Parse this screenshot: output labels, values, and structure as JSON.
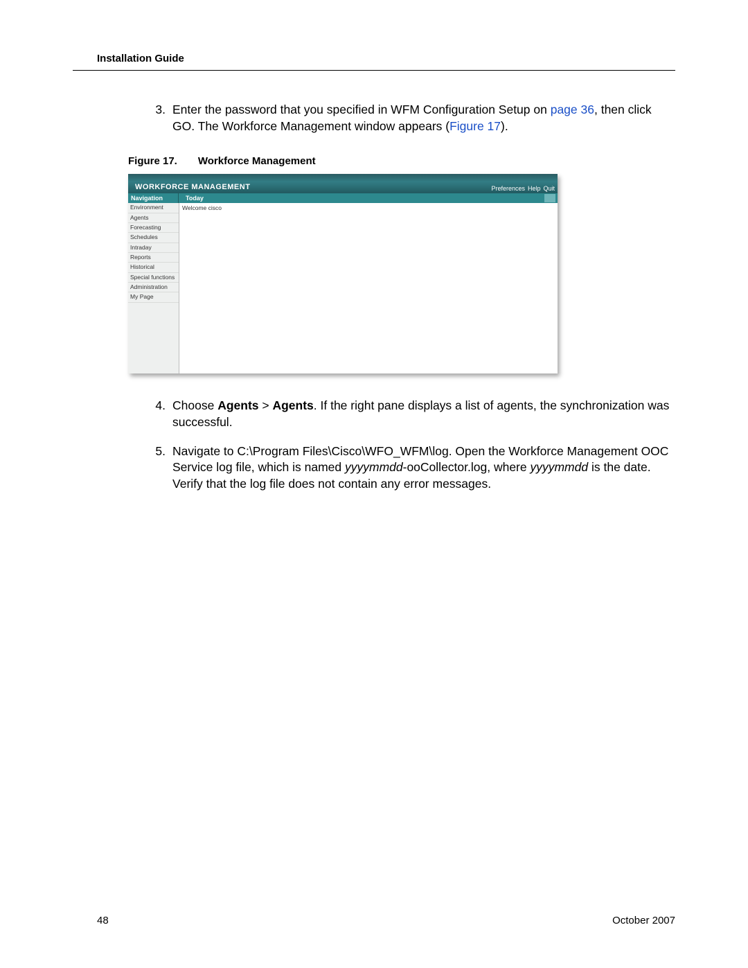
{
  "header": {
    "title": "Installation Guide"
  },
  "steps": {
    "s3": {
      "num": "3.",
      "pre": "Enter the password that you specified in WFM Configuration Setup on ",
      "link1": "page 36",
      "mid": ", then click GO. The Workforce Management window appears (",
      "link2": "Figure 17",
      "post": ")."
    },
    "s4": {
      "num": "4.",
      "pre": "Choose ",
      "b1": "Agents",
      "gt": " > ",
      "b2": "Agents",
      "post": ". If the right pane displays a list of agents, the synchronization was successful."
    },
    "s5": {
      "num": "5.",
      "pre": "Navigate to C:\\Program Files\\Cisco\\WFO_WFM\\log. Open the Workforce Management OOC Service log file, which is named ",
      "i1": "yyyymmdd",
      "mid1": "-ooCollector.log, where ",
      "i2": "yyyymmdd",
      "post": " is the date. Verify that the log file does not contain any error messages."
    }
  },
  "figure": {
    "num": "Figure 17.",
    "title": "Workforce Management"
  },
  "shot": {
    "title": "WORKFORCE MANAGEMENT",
    "toplinks": [
      "Preferences",
      "Help",
      "Quit"
    ],
    "navHeader": "Navigation",
    "today": "Today",
    "welcome": "Welcome cisco",
    "sidebar": [
      "Environment",
      "Agents",
      "Forecasting",
      "Schedules",
      "Intraday",
      "Reports",
      "Historical",
      "Special functions",
      "Administration",
      "My Page"
    ]
  },
  "footer": {
    "page": "48",
    "date": "October 2007"
  }
}
